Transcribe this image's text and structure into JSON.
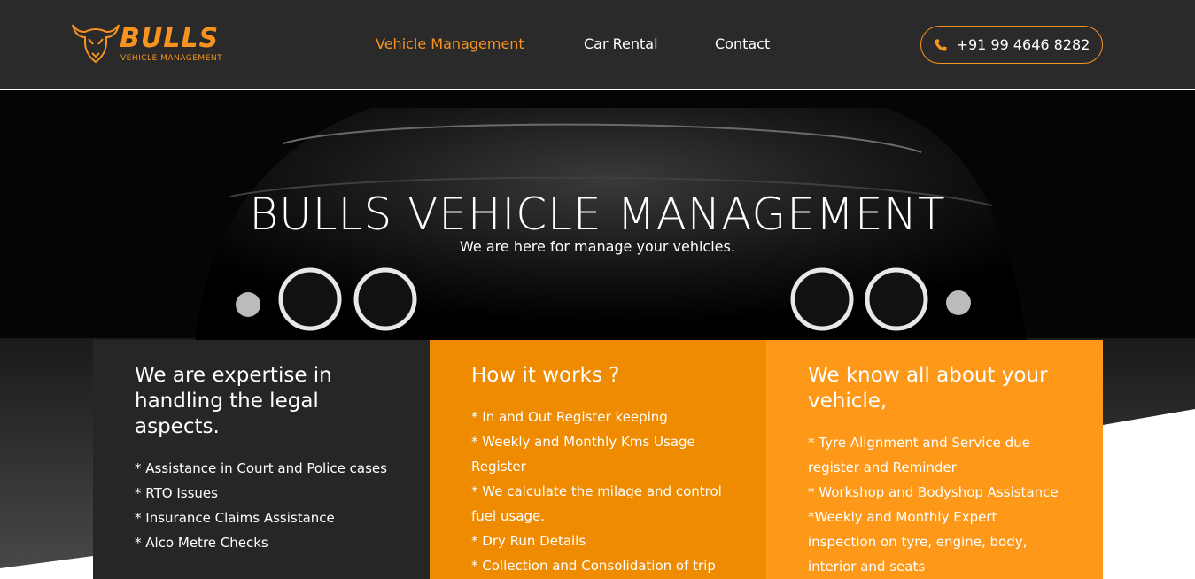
{
  "header": {
    "logo": {
      "word": "BULLS",
      "tagline": "VEHICLE MANAGEMENT"
    },
    "nav": [
      {
        "label": "Vehicle Management",
        "active": true
      },
      {
        "label": "Car Rental",
        "active": false
      },
      {
        "label": "Contact",
        "active": false
      }
    ],
    "phone": {
      "icon": "phone-icon",
      "number": "+91 99 4646 8282"
    }
  },
  "hero": {
    "title": "BULLS VEHICLE MANAGEMENT",
    "subtitle": "We are here for manage your vehicles."
  },
  "cards": [
    {
      "title": "We are expertise in handling the legal aspects.",
      "items": [
        "* Assistance in Court and Police cases",
        "* RTO Issues",
        "* Insurance Claims Assistance",
        "* Alco Metre Checks"
      ]
    },
    {
      "title": "How it works ?",
      "items": [
        "* In and Out Register keeping",
        "* Weekly and Monthly Kms Usage Register",
        "* We calculate the milage and control fuel usage.",
        "* Dry Run Details",
        "* Collection and Consolidation of trip"
      ]
    },
    {
      "title": "We know all about your vehicle,",
      "items": [
        "* Tyre Alignment and Service due register and Reminder",
        "* Workshop and Bodyshop Assistance",
        "*Weekly and Monthly Expert inspection on tyre, engine, body, interior and seats"
      ]
    }
  ],
  "colors": {
    "accent": "#f7931e",
    "header_bg": "#2a2a2a",
    "card_dark": "#262626",
    "card_orange": "#ef8b00",
    "card_light_orange": "#fd9819"
  }
}
